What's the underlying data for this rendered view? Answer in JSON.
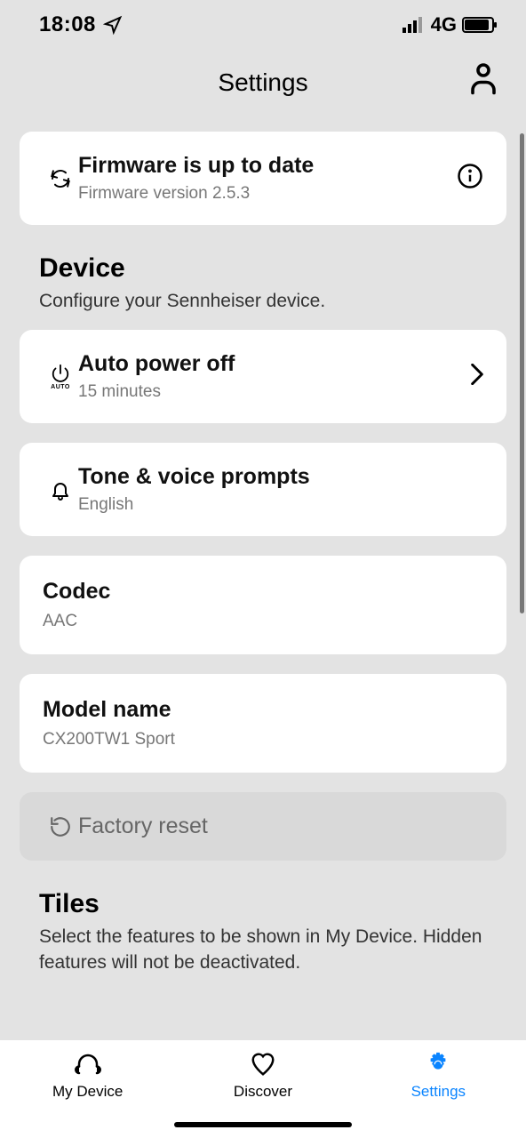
{
  "status": {
    "time": "18:08",
    "network": "4G"
  },
  "header": {
    "title": "Settings"
  },
  "firmware": {
    "title": "Firmware is up to date",
    "subtitle": "Firmware version 2.5.3"
  },
  "sections": {
    "device": {
      "title": "Device",
      "desc": "Configure your Sennheiser device."
    },
    "tiles": {
      "title": "Tiles",
      "desc": "Select the features to be shown in My Device. Hidden features will not be deactivated."
    }
  },
  "items": {
    "auto_power": {
      "title": "Auto power off",
      "subtitle": "15 minutes",
      "icon_sub": "AUTO"
    },
    "tone": {
      "title": "Tone & voice prompts",
      "subtitle": "English"
    },
    "codec": {
      "title": "Codec",
      "subtitle": "AAC"
    },
    "model": {
      "title": "Model name",
      "subtitle": "CX200TW1 Sport"
    },
    "factory": {
      "title": "Factory reset"
    }
  },
  "tabs": {
    "device": "My Device",
    "discover": "Discover",
    "settings": "Settings"
  }
}
